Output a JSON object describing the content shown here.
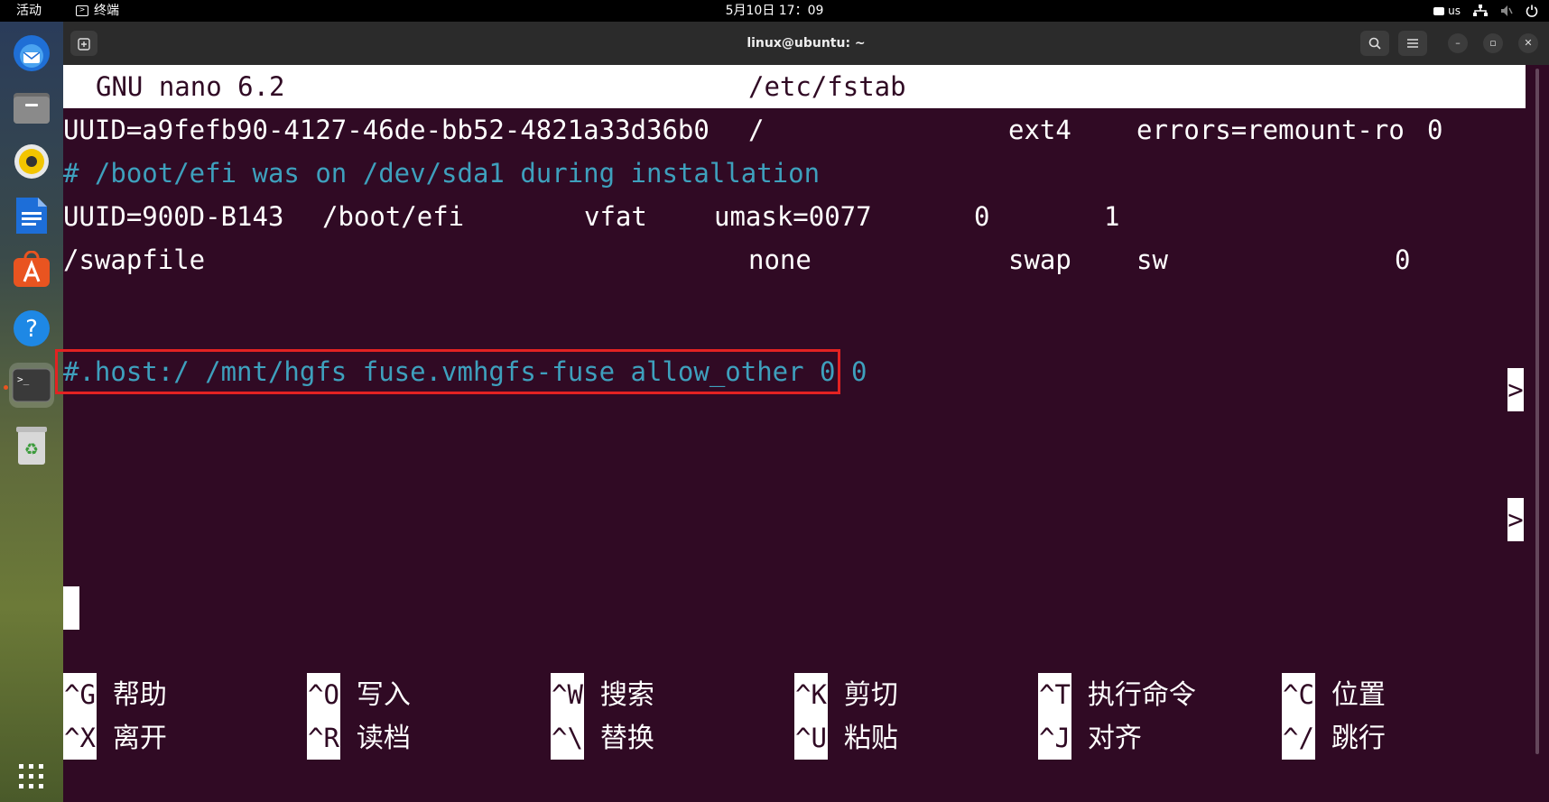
{
  "topbar": {
    "activities": "活动",
    "app_name": "终端",
    "clock": "5月10日 17：09",
    "keyboard": "us"
  },
  "window": {
    "title": "linux@ubuntu: ~"
  },
  "nano": {
    "version": "GNU nano 6.2",
    "filename": "/etc/fstab",
    "lines": [
      {
        "kind": "entry",
        "cols": [
          "UUID=a9fefb90-4127-46de-bb52-4821a33d36b0",
          "/",
          "ext4",
          "errors=remount-ro",
          "0"
        ],
        "more": ">"
      },
      {
        "kind": "comment",
        "text": "# /boot/efi was on /dev/sda1 during installation"
      },
      {
        "kind": "entry",
        "cols": [
          "UUID=900D-B143",
          "/boot/efi",
          "vfat",
          "umask=0077",
          "0",
          "1"
        ]
      },
      {
        "kind": "entry",
        "cols": [
          "/swapfile",
          "none",
          "swap",
          "sw",
          "0"
        ],
        "more": ">"
      },
      {
        "kind": "comment",
        "text": "#.host:/ /mnt/hgfs fuse.vmhgfs-fuse allow_other 0 0"
      }
    ],
    "shortcuts": [
      {
        "key": "^G",
        "label": "帮助"
      },
      {
        "key": "^O",
        "label": "写入"
      },
      {
        "key": "^W",
        "label": "搜索"
      },
      {
        "key": "^K",
        "label": "剪切"
      },
      {
        "key": "^T",
        "label": "执行命令"
      },
      {
        "key": "^C",
        "label": "位置"
      },
      {
        "key": "^X",
        "label": "离开"
      },
      {
        "key": "^R",
        "label": "读档"
      },
      {
        "key": "^\\",
        "label": "替换"
      },
      {
        "key": "^U",
        "label": "粘贴"
      },
      {
        "key": "^J",
        "label": "对齐"
      },
      {
        "key": "^/",
        "label": "跳行"
      }
    ]
  },
  "dock": {
    "items": [
      "thunderbird-icon",
      "files-icon",
      "rhythmbox-icon",
      "writer-icon",
      "app-center-icon",
      "help-icon",
      "terminal-icon",
      "trash-icon",
      "show-apps-icon"
    ]
  },
  "colors": {
    "terminal_bg": "#300a24",
    "comment": "#3ea0bd",
    "highlight_box": "#e32222"
  }
}
